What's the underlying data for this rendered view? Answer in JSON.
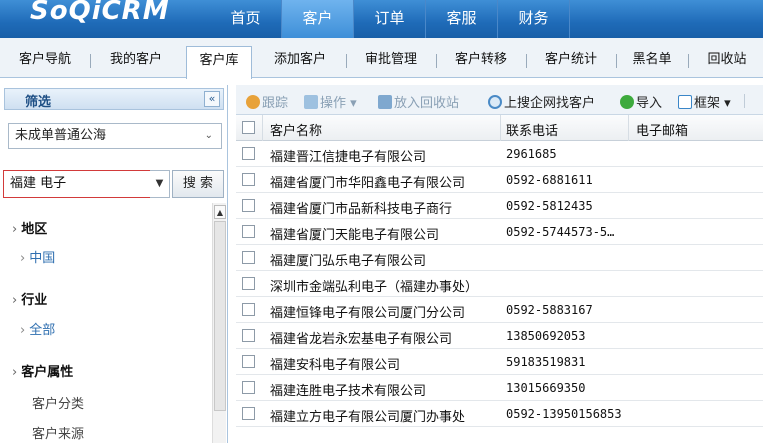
{
  "app": {
    "logo": "SoQiCRM"
  },
  "topnav": [
    {
      "label": "首页",
      "active": false
    },
    {
      "label": "客户",
      "active": true
    },
    {
      "label": "订单",
      "active": false
    },
    {
      "label": "客服",
      "active": false
    },
    {
      "label": "财务",
      "active": false
    }
  ],
  "subnav": [
    {
      "label": "客户导航"
    },
    {
      "label": "我的客户"
    },
    {
      "label": "客户库",
      "active": true
    },
    {
      "label": "添加客户"
    },
    {
      "label": "审批管理"
    },
    {
      "label": "客户转移"
    },
    {
      "label": "客户统计"
    },
    {
      "label": "黑名单"
    },
    {
      "label": "回收站"
    }
  ],
  "filter": {
    "title": "筛选",
    "collapse_glyph": "«",
    "pool_select": "未成单普通公海",
    "search_value": "福建 电子",
    "search_button": "搜 索",
    "categories": {
      "region": {
        "title": "地区",
        "link": "中国"
      },
      "industry": {
        "title": "行业",
        "link": "全部"
      },
      "attr": {
        "title": "客户属性",
        "items": [
          "客户分类",
          "客户来源"
        ]
      }
    }
  },
  "toolbar": {
    "track": "跟踪",
    "operate": "操作",
    "recycle": "放入回收站",
    "search_web": "上搜企网找客户",
    "import": "导入",
    "frame": "框架"
  },
  "table": {
    "headers": {
      "name": "客户名称",
      "phone": "联系电话",
      "email": "电子邮箱"
    },
    "rows": [
      {
        "name": "福建晋江信捷电子有限公司",
        "phone": "2961685"
      },
      {
        "name": "福建省厦门市华阳鑫电子有限公司",
        "phone": "0592-6881611"
      },
      {
        "name": "福建省厦门市品新科技电子商行",
        "phone": "0592-5812435"
      },
      {
        "name": "福建省厦门天能电子有限公司",
        "phone": "0592-5744573-5…"
      },
      {
        "name": "福建厦门弘乐电子有限公司",
        "phone": ""
      },
      {
        "name": "深圳市金端弘利电子（福建办事处）",
        "phone": ""
      },
      {
        "name": "福建恒锋电子有限公司厦门分公司",
        "phone": "0592-5883167"
      },
      {
        "name": "福建省龙岩永宏基电子有限公司",
        "phone": "13850692053"
      },
      {
        "name": "福建安科电子有限公司",
        "phone": "59183519831"
      },
      {
        "name": "福建连胜电子技术有限公司",
        "phone": "13015669350"
      },
      {
        "name": "福建立方电子有限公司厦门办事处",
        "phone": "0592-13950156853"
      }
    ]
  },
  "colors": {
    "brand_blue": "#1f6bb8",
    "active_tab": "#3e8fd8",
    "link": "#2f6fb0",
    "highlight_border": "#d23a3a"
  }
}
